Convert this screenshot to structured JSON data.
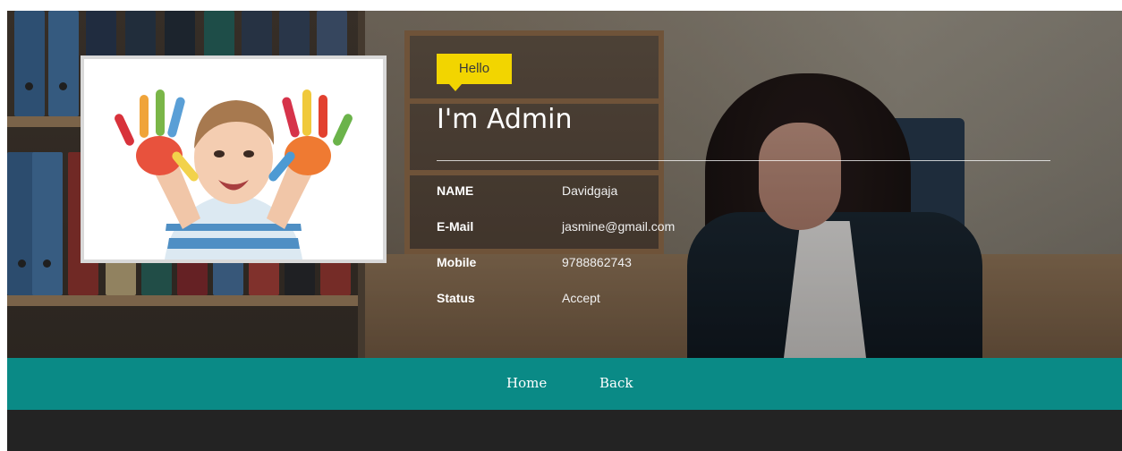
{
  "profile": {
    "greeting": "Hello",
    "title": "I'm Admin",
    "photo_alt": "child-painted-hands"
  },
  "details": [
    {
      "label": "NAME",
      "value": "Davidgaja"
    },
    {
      "label": "E-Mail",
      "value": "jasmine@gmail.com"
    },
    {
      "label": "Mobile",
      "value": "9788862743"
    },
    {
      "label": "Status",
      "value": "Accept"
    }
  ],
  "nav": {
    "home": "Home",
    "back": "Back"
  },
  "colors": {
    "accent_yellow": "#f2d500",
    "nav_teal": "#0a8a86",
    "footer_dark": "#232323"
  }
}
